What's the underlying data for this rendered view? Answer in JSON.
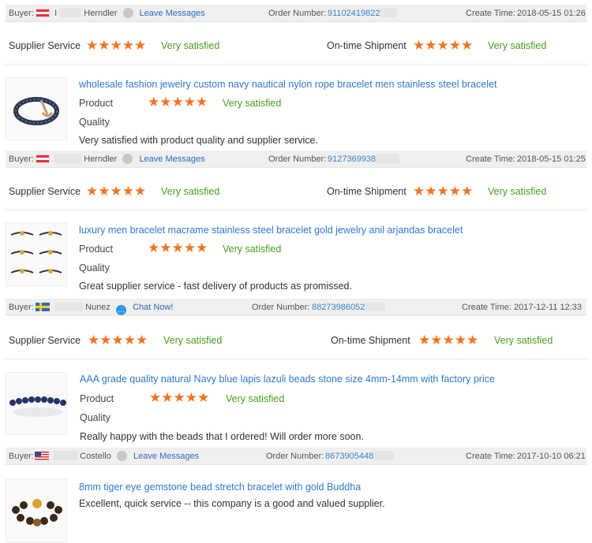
{
  "reviews": [
    {
      "buyer_label": "Buyer:",
      "buyer_initial": "I",
      "buyer_name": "Herndler",
      "contact": "Leave Messages",
      "order_label": "Order Number:",
      "order_value": "91102419822",
      "time_label": "Create Time:",
      "time_value": "2018-05-15 01:26",
      "supplier_label": "Supplier Service",
      "supplier_stars": "★★★★★",
      "supplier_text": "Very satisfied",
      "shipment_label": "On-time Shipment",
      "shipment_stars": "★★★★★",
      "shipment_text": "Very satisfied",
      "product_title": "wholesale fashion jewelry custom navy nautical nylon rope bracelet men stainless steel bracelet",
      "product_label": "Product",
      "quality_label": "Quality",
      "product_stars": "★★★★★",
      "product_text": "Very satisfied",
      "comment": "Very satisfied with product quality and supplier service."
    },
    {
      "buyer_label": "Buyer:",
      "buyer_initial": "",
      "buyer_name": "Herndler",
      "contact": "Leave Messages",
      "order_label": "Order Number:",
      "order_value": "9127369938",
      "time_label": "Create Time:",
      "time_value": "2018-05-15 01:25",
      "supplier_label": "Supplier Service",
      "supplier_stars": "★★★★★",
      "supplier_text": "Very satisfied",
      "shipment_label": "On-time Shipment",
      "shipment_stars": "★★★★★",
      "shipment_text": "Very satisfied",
      "product_title": "luxury men bracelet macrame stainless steel bracelet gold jewelry anil arjandas bracelet",
      "product_label": "Product",
      "quality_label": "Quality",
      "product_stars": "★★★★★",
      "product_text": "Very satisfied",
      "comment": "Great supplier service - fast delivery of products as promissed."
    },
    {
      "buyer_label": "Buyer:",
      "buyer_initial": "",
      "buyer_name": "Nunez",
      "contact": "Chat Now!",
      "order_label": "Order Number:",
      "order_value": "88273986052",
      "time_label": "Create Time:",
      "time_value": "2017-12-11 12:33",
      "supplier_label": "Supplier Service",
      "supplier_stars": "★★★★★",
      "supplier_text": "Very satisfied",
      "shipment_label": "On-time Shipment",
      "shipment_stars": "★★★★★",
      "shipment_text": "Very satisfied",
      "product_title": "AAA grade quality natural Navy blue lapis lazuli beads stone size 4mm-14mm with factory price",
      "product_label": "Product",
      "quality_label": "Quality",
      "product_stars": "★★★★★",
      "product_text": "Very satisfied",
      "comment": "Really happy with the beads that I ordered! Will order more soon."
    },
    {
      "buyer_label": "Buyer:",
      "buyer_initial": "",
      "buyer_name": "Costello",
      "contact": "Leave Messages",
      "order_label": "Order Number:",
      "order_value": "8673905448",
      "time_label": "Create Time:",
      "time_value": "2017-10-10 06:21",
      "product_title": "8mm tiger eye gemstone bead stretch bracelet with gold Buddha",
      "comment": "Excellent, quick service -- this company is a good and valued supplier."
    }
  ],
  "colors": {
    "star": "#f37321",
    "satisfied": "#47a01a",
    "link": "#2d69b8",
    "header_bg": "#efefef"
  }
}
